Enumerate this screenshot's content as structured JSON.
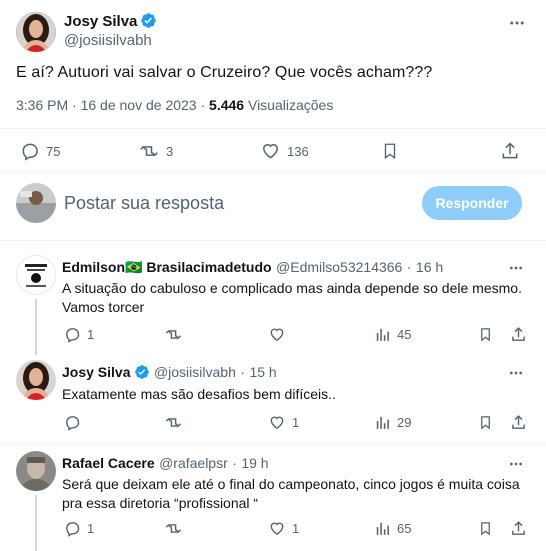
{
  "main_tweet": {
    "author_name": "Josy Silva",
    "author_handle": "@josiisilvabh",
    "text": "E aí? Autuori vai salvar o Cruzeiro? Que vocês acham???",
    "time": "3:36 PM",
    "date": "16 de nov de 2023",
    "views": "5.446",
    "views_label": "Visualizações",
    "replies": "75",
    "retweets": "3",
    "likes": "136"
  },
  "reply_box": {
    "placeholder": "Postar sua resposta",
    "button_label": "Responder"
  },
  "replies": [
    {
      "author_name": "Edmilson🇧🇷 Brasilacimadetudo",
      "author_handle": "@Edmilso53214366",
      "time_ago": "16 h",
      "text_line1": "A situação do cabuloso e complicado mas ainda depende so dele mesmo.",
      "text_line2": "Vamos torcer",
      "replies": "1",
      "likes": "",
      "views": "45"
    },
    {
      "author_name": "Josy Silva",
      "author_handle": "@josiisilvabh",
      "time_ago": "15 h",
      "text_line1": "Exatamente mas são desafios bem difíceis..",
      "replies": "",
      "likes": "1",
      "views": "29"
    },
    {
      "author_name": "Rafael Cacere",
      "author_handle": "@rafaelpsr",
      "time_ago": "19 h",
      "text_line1": "Será que deixam ele até o final do campeonato, cinco jogos é muita coisa",
      "text_line2": "pra essa diretoria “profissional “",
      "replies": "1",
      "likes": "1",
      "views": "65"
    }
  ],
  "separator": "·",
  "colors": {
    "verified": "#1d9bf0",
    "secondary_text": "#536471",
    "button_disabled": "#8ecdf8",
    "divider": "#eff3f4"
  }
}
